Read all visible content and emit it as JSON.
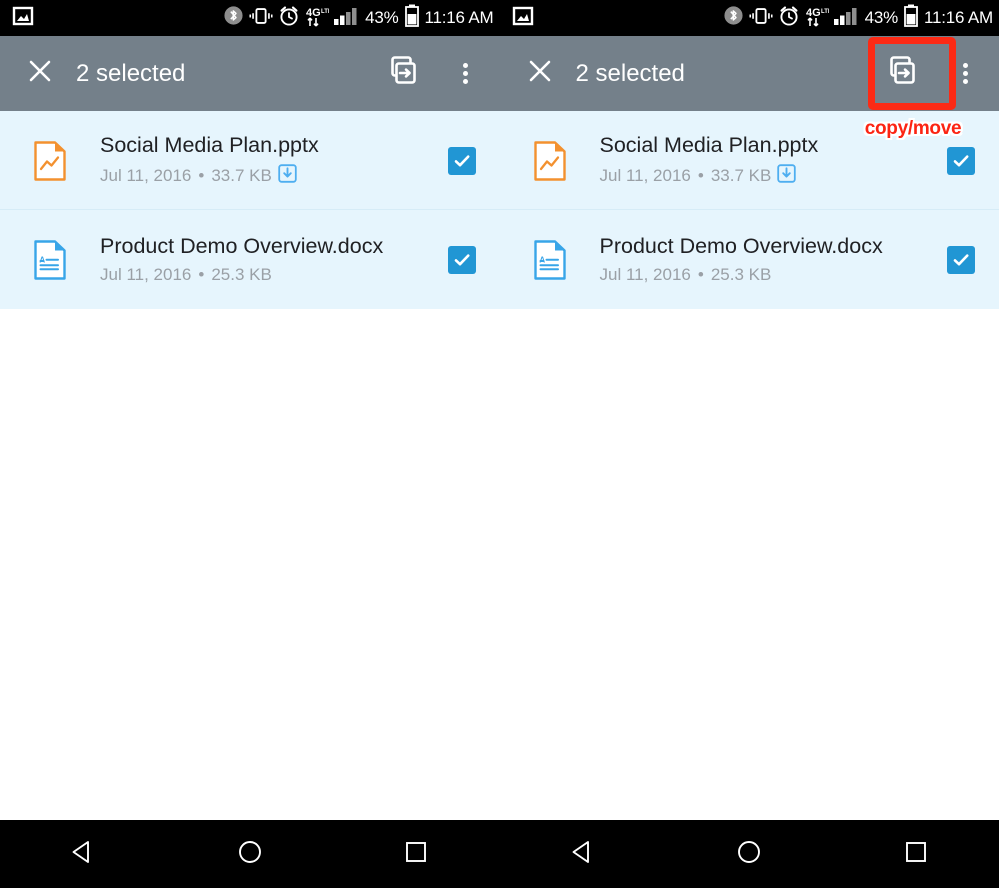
{
  "status_bar": {
    "notification_icon": "image-icon",
    "icons": [
      "bluetooth-icon",
      "vibrate-icon",
      "alarm-icon",
      "4g-lte-icon",
      "signal-bars-icon"
    ],
    "battery_percent": "43%",
    "battery_icon": "battery-icon",
    "time": "11:16 AM"
  },
  "toolbar": {
    "close_icon": "close-icon",
    "title": "2 selected",
    "copy_move_icon": "copy-move-icon",
    "overflow_icon": "overflow-menu-icon",
    "toolbar_color": "#74808a"
  },
  "files": [
    {
      "icon": "pptx-file-icon",
      "icon_color": "#f3912f",
      "name": "Social Media Plan.pptx",
      "date": "Jul 11, 2016",
      "separator": "•",
      "size": "33.7 KB",
      "badge": "download-available-icon",
      "has_badge": true,
      "checked": true
    },
    {
      "icon": "docx-file-icon",
      "icon_color": "#38a5e8",
      "name": "Product Demo Overview.docx",
      "date": "Jul 11, 2016",
      "separator": "•",
      "size": "25.3 KB",
      "badge": "",
      "has_badge": false,
      "checked": true
    }
  ],
  "annotation": {
    "label": "copy/move",
    "color": "#fc2413",
    "target": "copy-move-button"
  },
  "nav_bar": {
    "back": "back-triangle-icon",
    "home": "home-circle-icon",
    "recents": "recents-square-icon"
  },
  "colors": {
    "list_background": "#e6f5fd",
    "checkbox": "#2196d4",
    "accent_blue": "#2196d4"
  }
}
